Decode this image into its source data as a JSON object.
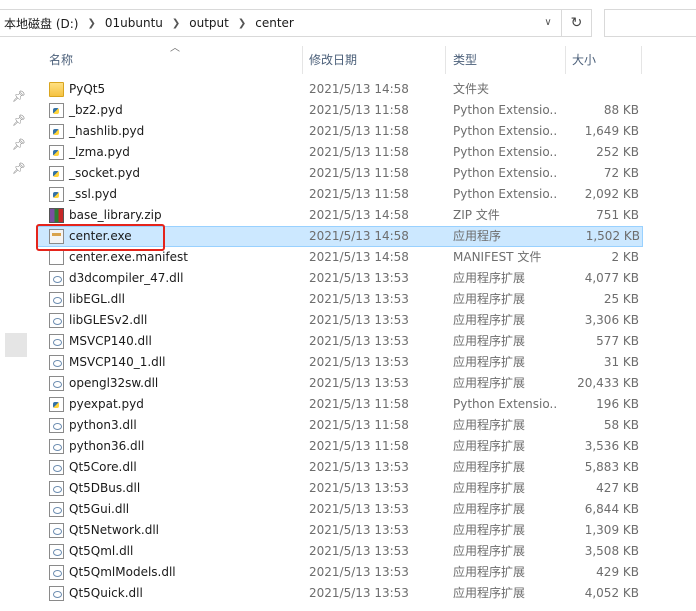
{
  "address": {
    "crumbs": [
      "本地磁盘 (D:)",
      "01ubuntu",
      "output",
      "center"
    ]
  },
  "columns": {
    "name": "名称",
    "date": "修改日期",
    "type": "类型",
    "size": "大小"
  },
  "files": [
    {
      "name": "PyQt5",
      "date": "2021/5/13 14:58",
      "type": "文件夹",
      "size": "",
      "icon": "folder-icon"
    },
    {
      "name": "_bz2.pyd",
      "date": "2021/5/13 11:58",
      "type": "Python Extensio...",
      "size": "88 KB",
      "icon": "python-file-icon"
    },
    {
      "name": "_hashlib.pyd",
      "date": "2021/5/13 11:58",
      "type": "Python Extensio...",
      "size": "1,649 KB",
      "icon": "python-file-icon"
    },
    {
      "name": "_lzma.pyd",
      "date": "2021/5/13 11:58",
      "type": "Python Extensio...",
      "size": "252 KB",
      "icon": "python-file-icon"
    },
    {
      "name": "_socket.pyd",
      "date": "2021/5/13 11:58",
      "type": "Python Extensio...",
      "size": "72 KB",
      "icon": "python-file-icon"
    },
    {
      "name": "_ssl.pyd",
      "date": "2021/5/13 11:58",
      "type": "Python Extensio...",
      "size": "2,092 KB",
      "icon": "python-file-icon"
    },
    {
      "name": "base_library.zip",
      "date": "2021/5/13 14:58",
      "type": "ZIP 文件",
      "size": "751 KB",
      "icon": "zip-archive-icon"
    },
    {
      "name": "center.exe",
      "date": "2021/5/13 14:58",
      "type": "应用程序",
      "size": "1,502 KB",
      "icon": "executable-icon",
      "selected": true
    },
    {
      "name": "center.exe.manifest",
      "date": "2021/5/13 14:58",
      "type": "MANIFEST 文件",
      "size": "2 KB",
      "icon": "document-icon"
    },
    {
      "name": "d3dcompiler_47.dll",
      "date": "2021/5/13 13:53",
      "type": "应用程序扩展",
      "size": "4,077 KB",
      "icon": "dll-icon"
    },
    {
      "name": "libEGL.dll",
      "date": "2021/5/13 13:53",
      "type": "应用程序扩展",
      "size": "25 KB",
      "icon": "dll-icon"
    },
    {
      "name": "libGLESv2.dll",
      "date": "2021/5/13 13:53",
      "type": "应用程序扩展",
      "size": "3,306 KB",
      "icon": "dll-icon"
    },
    {
      "name": "MSVCP140.dll",
      "date": "2021/5/13 13:53",
      "type": "应用程序扩展",
      "size": "577 KB",
      "icon": "dll-icon"
    },
    {
      "name": "MSVCP140_1.dll",
      "date": "2021/5/13 13:53",
      "type": "应用程序扩展",
      "size": "31 KB",
      "icon": "dll-icon"
    },
    {
      "name": "opengl32sw.dll",
      "date": "2021/5/13 13:53",
      "type": "应用程序扩展",
      "size": "20,433 KB",
      "icon": "dll-icon"
    },
    {
      "name": "pyexpat.pyd",
      "date": "2021/5/13 11:58",
      "type": "Python Extensio...",
      "size": "196 KB",
      "icon": "python-file-icon"
    },
    {
      "name": "python3.dll",
      "date": "2021/5/13 11:58",
      "type": "应用程序扩展",
      "size": "58 KB",
      "icon": "dll-icon"
    },
    {
      "name": "python36.dll",
      "date": "2021/5/13 11:58",
      "type": "应用程序扩展",
      "size": "3,536 KB",
      "icon": "dll-icon"
    },
    {
      "name": "Qt5Core.dll",
      "date": "2021/5/13 13:53",
      "type": "应用程序扩展",
      "size": "5,883 KB",
      "icon": "dll-icon"
    },
    {
      "name": "Qt5DBus.dll",
      "date": "2021/5/13 13:53",
      "type": "应用程序扩展",
      "size": "427 KB",
      "icon": "dll-icon"
    },
    {
      "name": "Qt5Gui.dll",
      "date": "2021/5/13 13:53",
      "type": "应用程序扩展",
      "size": "6,844 KB",
      "icon": "dll-icon"
    },
    {
      "name": "Qt5Network.dll",
      "date": "2021/5/13 13:53",
      "type": "应用程序扩展",
      "size": "1,309 KB",
      "icon": "dll-icon"
    },
    {
      "name": "Qt5Qml.dll",
      "date": "2021/5/13 13:53",
      "type": "应用程序扩展",
      "size": "3,508 KB",
      "icon": "dll-icon"
    },
    {
      "name": "Qt5QmlModels.dll",
      "date": "2021/5/13 13:53",
      "type": "应用程序扩展",
      "size": "429 KB",
      "icon": "dll-icon"
    },
    {
      "name": "Qt5Quick.dll",
      "date": "2021/5/13 13:53",
      "type": "应用程序扩展",
      "size": "4,052 KB",
      "icon": "dll-icon"
    }
  ]
}
